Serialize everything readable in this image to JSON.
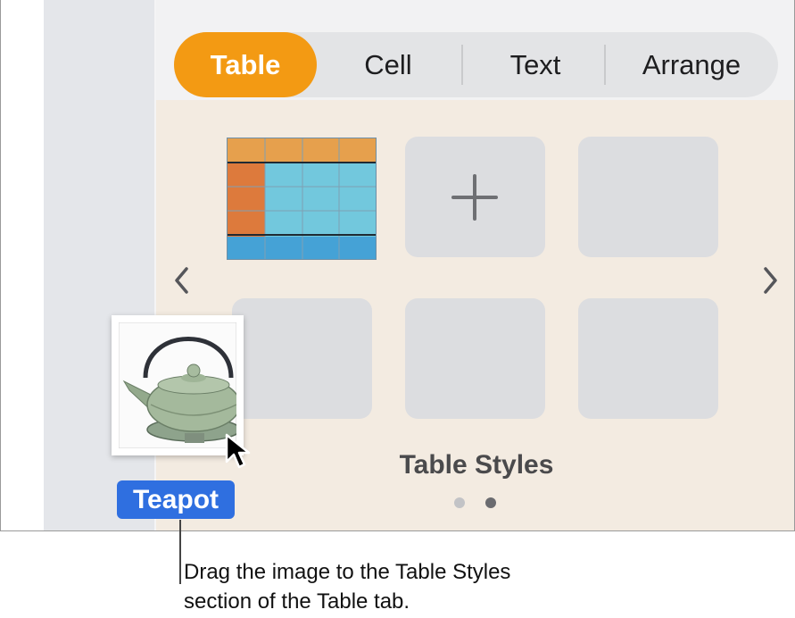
{
  "tabs": [
    {
      "label": "Table",
      "selected": true
    },
    {
      "label": "Cell",
      "selected": false
    },
    {
      "label": "Text",
      "selected": false
    },
    {
      "label": "Arrange",
      "selected": false
    }
  ],
  "icons": {
    "prev": "chevron-left-icon",
    "next": "chevron-right-icon",
    "add": "plus-icon",
    "cursor": "pointer-cursor-icon"
  },
  "table_styles": {
    "title": "Table Styles",
    "page_count": 2,
    "current_page": 2
  },
  "drag": {
    "badge": "Teapot"
  },
  "callout": {
    "text": "Drag the image to the Table Styles section of the Table tab."
  },
  "colors": {
    "accent_tab": "#f39a13",
    "badge": "#2f6fe0",
    "grid_header": "#e6a04d",
    "grid_first_col": "#dd7a3c",
    "grid_body": "#72c8dd",
    "grid_footer": "#45a2d6"
  }
}
